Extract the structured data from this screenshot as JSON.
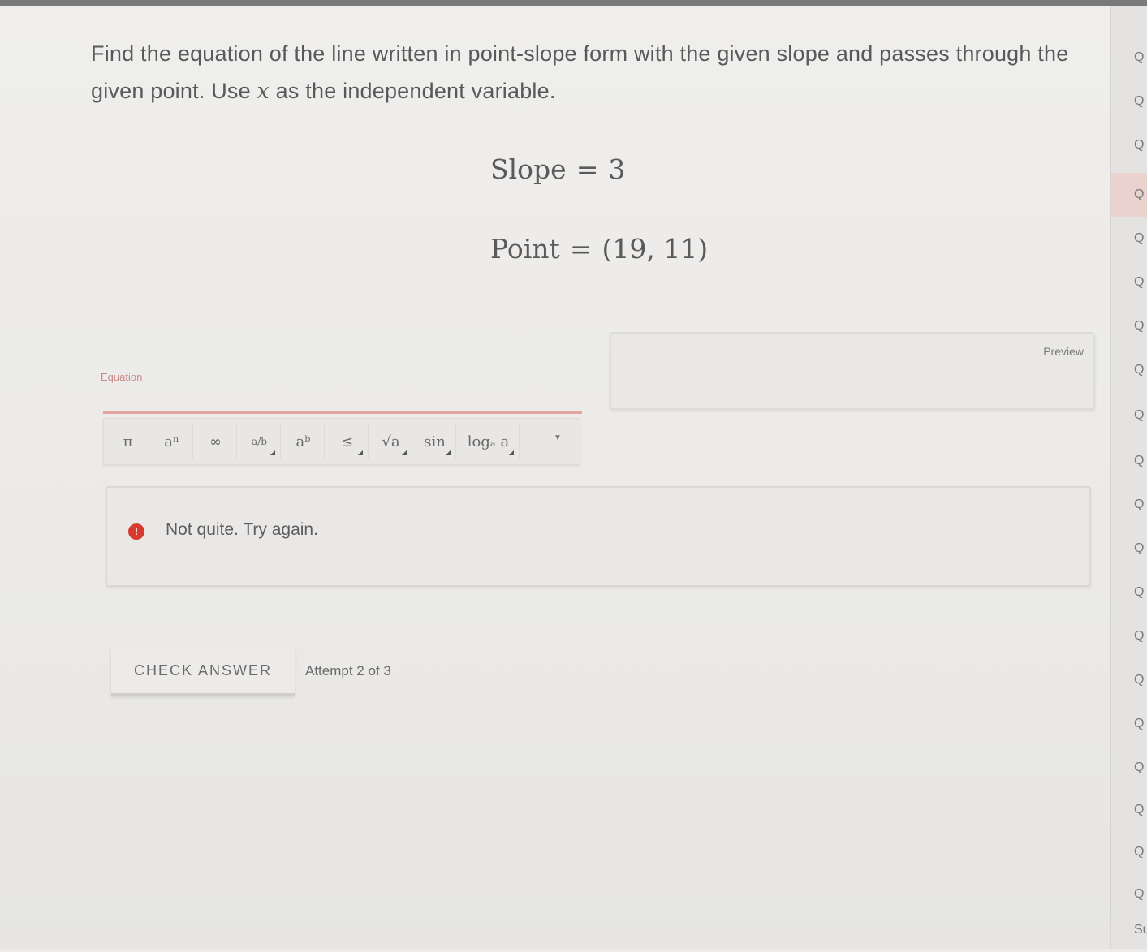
{
  "question": {
    "text_before": "Find the equation of the line written in point-slope form with the given slope and passes through the given point. Use ",
    "variable": "x",
    "text_after": " as the independent variable."
  },
  "given": {
    "slope_label": "Slope",
    "slope_value": "3",
    "point_label": "Point",
    "point_value": "(19, 11)",
    "equals": "="
  },
  "answer": {
    "input_label": "Equation",
    "input_value": "",
    "preview_label": "Preview"
  },
  "toolbar": {
    "buttons": [
      {
        "label": "π",
        "has_submenu": false
      },
      {
        "label": "aⁿ",
        "has_submenu": false
      },
      {
        "label": "∞",
        "has_submenu": false
      },
      {
        "label": "a/b",
        "has_submenu": true
      },
      {
        "label": "aᵇ",
        "has_submenu": false
      },
      {
        "label": "≤",
        "has_submenu": true
      },
      {
        "label": "√a",
        "has_submenu": true
      },
      {
        "label": "sin",
        "has_submenu": true
      },
      {
        "label": "logₐ a",
        "has_submenu": true
      }
    ],
    "more_icon": "chevron-down-icon"
  },
  "feedback": {
    "icon": "error-icon",
    "icon_glyph": "!",
    "message": "Not quite. Try again.",
    "color": "#d93a2f"
  },
  "actions": {
    "check_label": "CHECK ANSWER",
    "attempt_text": "Attempt 2 of 3"
  },
  "sidebar": {
    "items": [
      "Q",
      "Q",
      "Q",
      "Q",
      "Q",
      "Q",
      "Q",
      "Q",
      "Q",
      "Q",
      "Q",
      "Q",
      "Q",
      "Q",
      "Q",
      "Q",
      "Q",
      "Q",
      "Q",
      "Q"
    ],
    "active_index": 3,
    "footer_label": "Su"
  }
}
